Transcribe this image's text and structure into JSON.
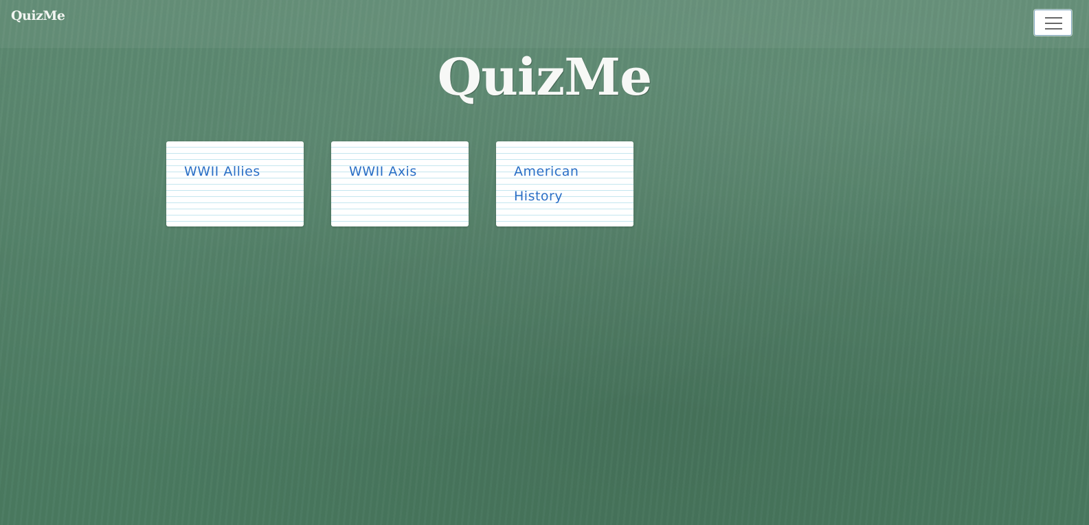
{
  "navbar": {
    "brand": "QuizMe",
    "menu_icon": "hamburger-menu-icon"
  },
  "hero": {
    "title": "QuizMe"
  },
  "quizzes": [
    {
      "title": "WWII Allies"
    },
    {
      "title": "WWII Axis"
    },
    {
      "title": "American History"
    }
  ],
  "colors": {
    "background": "#4f7f66",
    "card_text": "#2a6fc6",
    "card_line": "#c4e6ef",
    "title_text": "#f7f8f6"
  }
}
